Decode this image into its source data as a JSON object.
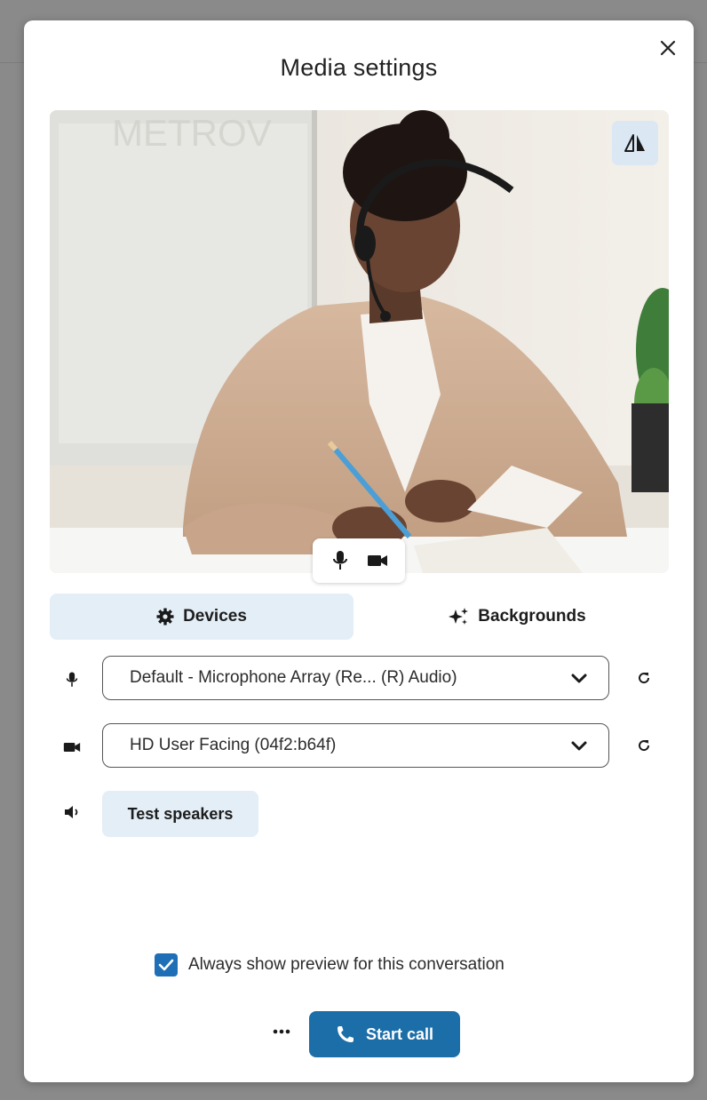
{
  "dialog": {
    "title": "Media settings",
    "close_label": "×"
  },
  "preview": {
    "photo_description": "woman with headset writing at desk",
    "mirror_icon": "mirror-icon",
    "toggles": {
      "mic_icon": "microphone-icon",
      "camera_icon": "camera-icon"
    }
  },
  "tabs": [
    {
      "label": "Devices",
      "icon": "gear-icon",
      "active": true
    },
    {
      "label": "Backgrounds",
      "icon": "sparkle-icon",
      "active": false
    }
  ],
  "devices": {
    "microphone": {
      "icon": "microphone-icon",
      "value": "Default - Microphone Array (Re... (R) Audio)"
    },
    "camera": {
      "icon": "camera-icon",
      "value": "HD User Facing (04f2:b64f)"
    },
    "speaker": {
      "icon": "speaker-icon",
      "test_label": "Test speakers"
    }
  },
  "footer": {
    "always_show_label": "Always show preview for this conversation",
    "always_show_checked": true,
    "more_label": "···",
    "start_call_label": "Start call"
  },
  "colors": {
    "accent": "#1c6ea8",
    "tab_active_bg": "#e4eef7",
    "checkbox": "#1f6fb6"
  }
}
